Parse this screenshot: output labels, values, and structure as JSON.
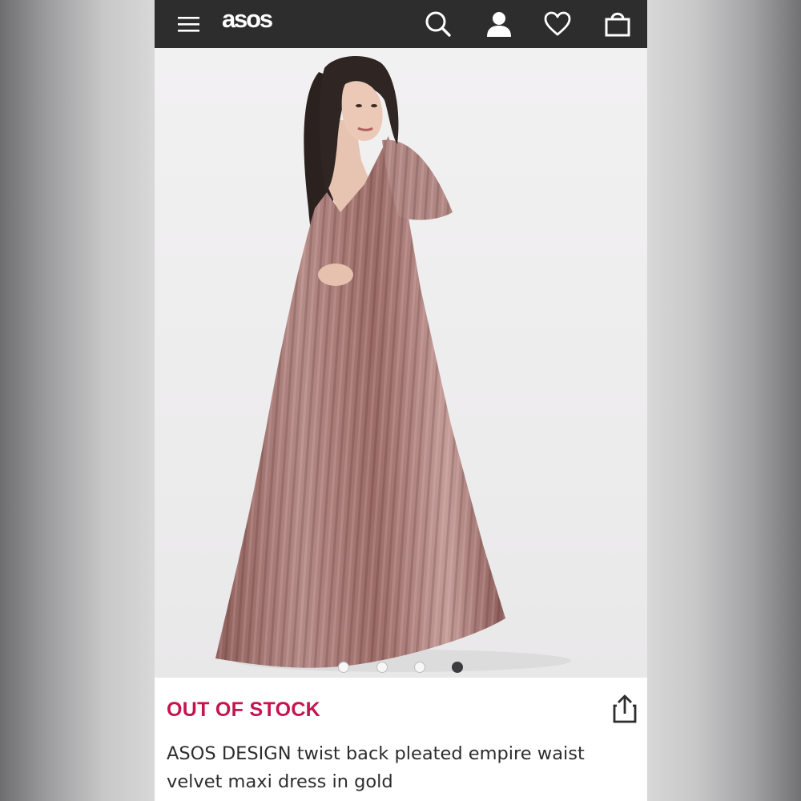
{
  "header": {
    "logo": "asos",
    "icons": {
      "menu": "hamburger-menu-icon",
      "search": "search-icon",
      "account": "account-icon",
      "wishlist": "heart-icon",
      "bag": "shopping-bag-icon"
    },
    "colors": {
      "bar": "#2d2d2d",
      "icon": "#ffffff"
    }
  },
  "product": {
    "image_description_icon": "product-photo",
    "carousel": {
      "count": 4,
      "active_index": 3
    },
    "stock_status": "OUT OF STOCK",
    "share_icon": "share-icon",
    "title": "ASOS DESIGN twist back pleated empire waist velvet maxi dress in gold",
    "colors": {
      "stock_status": "#c4154e",
      "title": "#2d2d2d",
      "dress": "#a27470"
    }
  }
}
